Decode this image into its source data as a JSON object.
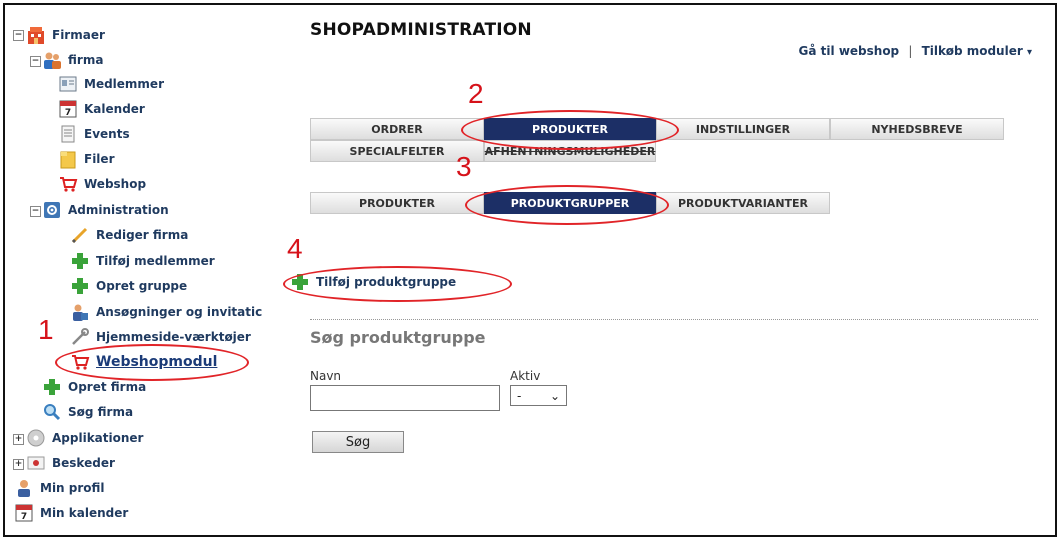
{
  "sidebar": {
    "items": [
      {
        "label": "Firmaer"
      },
      {
        "label": "firma"
      },
      {
        "label": "Medlemmer"
      },
      {
        "label": "Kalender"
      },
      {
        "label": "Events"
      },
      {
        "label": "Filer"
      },
      {
        "label": "Webshop"
      },
      {
        "label": "Administration"
      },
      {
        "label": "Rediger firma"
      },
      {
        "label": "Tilføj medlemmer"
      },
      {
        "label": "Opret gruppe"
      },
      {
        "label": "Ansøgninger og invitatic"
      },
      {
        "label": "Hjemmeside-værktøjer"
      },
      {
        "label": "Webshopmodul"
      },
      {
        "label": "Opret firma"
      },
      {
        "label": "Søg firma"
      },
      {
        "label": "Applikationer"
      },
      {
        "label": "Beskeder"
      },
      {
        "label": "Min profil"
      },
      {
        "label": "Min kalender"
      }
    ]
  },
  "header": {
    "title": "SHOPADMINISTRATION",
    "link_webshop": "Gå til webshop",
    "link_sep": "|",
    "link_modules": "Tilkøb moduler"
  },
  "tabs_main": [
    "ORDRER",
    "PRODUKTER",
    "INDSTILLINGER",
    "NYHEDSBREVE",
    "SPECIALFELTER",
    "AFHENTNINGSMULIGHEDER"
  ],
  "tabs_sub": [
    "PRODUKTER",
    "PRODUKTGRUPPER",
    "PRODUKTVARIANTER"
  ],
  "add_link": "Tilføj produktgruppe",
  "search": {
    "heading": "Søg produktgruppe",
    "name_label": "Navn",
    "name_value": "",
    "active_label": "Aktiv",
    "active_value": "-",
    "button": "Søg"
  },
  "annotations": [
    "1",
    "2",
    "3",
    "4"
  ],
  "colors": {
    "accent": "#1c2f66",
    "annotation": "#e12428",
    "link": "#1f3a5f"
  }
}
